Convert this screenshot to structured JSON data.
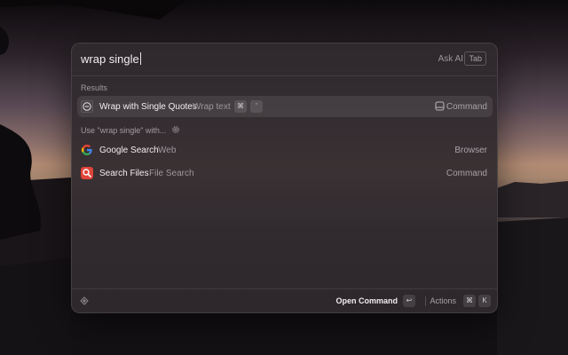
{
  "search": {
    "query": "wrap single",
    "ask_ai": "Ask AI",
    "tab_key": "Tab"
  },
  "results": {
    "section_label": "Results",
    "items": [
      {
        "title": "Wrap with Single Quotes",
        "subtitle": "Wrap text",
        "shortcut_keys": [
          "⌘",
          "'"
        ],
        "type": "Command",
        "icon": "quote-icon",
        "selected": true
      }
    ]
  },
  "fallback": {
    "section_label": "Use \"wrap single\" with...",
    "items": [
      {
        "title": "Google Search",
        "subtitle": "Web",
        "type": "Browser",
        "icon": "google-icon"
      },
      {
        "title": "Search Files",
        "subtitle": "File Search",
        "type": "Command",
        "icon": "search-files-icon"
      }
    ]
  },
  "footer": {
    "open_command": "Open Command",
    "enter_key": "↩",
    "actions": "Actions",
    "actions_keys": [
      "⌘",
      "K"
    ]
  },
  "colors": {
    "panel": "#302a2e",
    "google_red": "#ea4335",
    "search_files_red": "#e0443a"
  }
}
